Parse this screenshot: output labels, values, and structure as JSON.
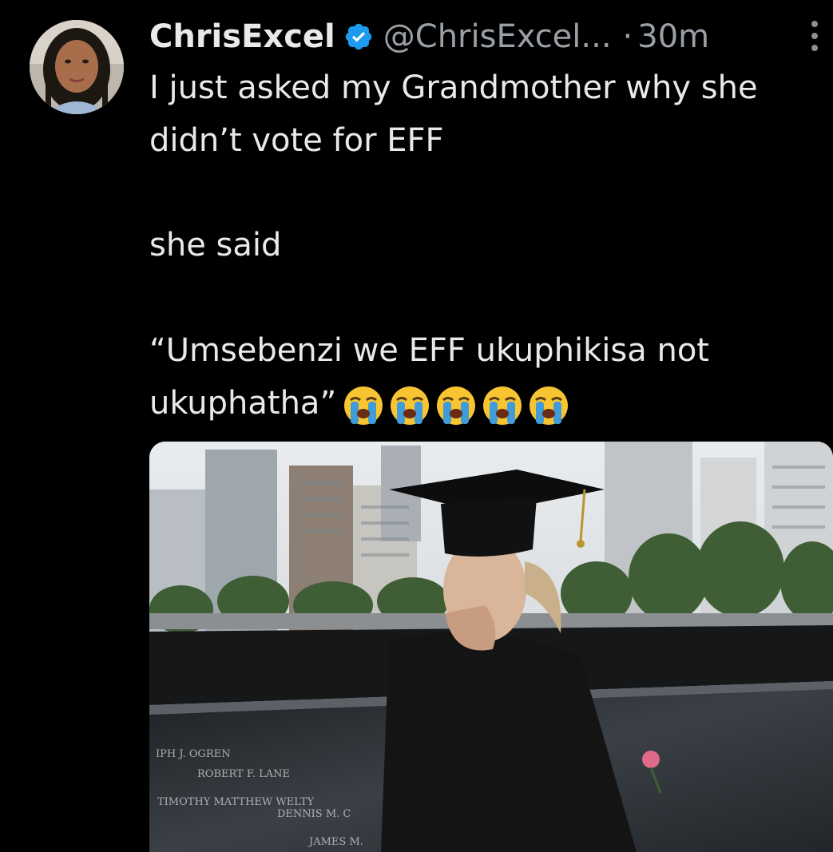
{
  "author": {
    "display_name": "ChrisExcel",
    "handle": "@ChrisExcel...",
    "separator": "·",
    "time": "30m",
    "verified": true,
    "verified_color": "#1d9bf0"
  },
  "tweet": {
    "lines": [
      "I just asked my Grandmother why she",
      "didn’t vote for EFF",
      "she said",
      "“Umsebenzi we EFF ukuphikisa not",
      "ukuphatha”"
    ],
    "emojis": [
      "crying-face-emoji",
      "crying-face-emoji",
      "crying-face-emoji",
      "crying-face-emoji",
      "crying-face-emoji"
    ]
  },
  "media": {
    "engraved_names": [
      "IPH J. OGREN",
      "ROBERT F. LANE",
      "TIMOTHY MATTHEW WELTY",
      "DENNIS M. C",
      "JAMES M."
    ]
  },
  "theme": {
    "background": "#000000",
    "text": "#e7e9ea",
    "secondary_text": "#9aa0a6"
  }
}
